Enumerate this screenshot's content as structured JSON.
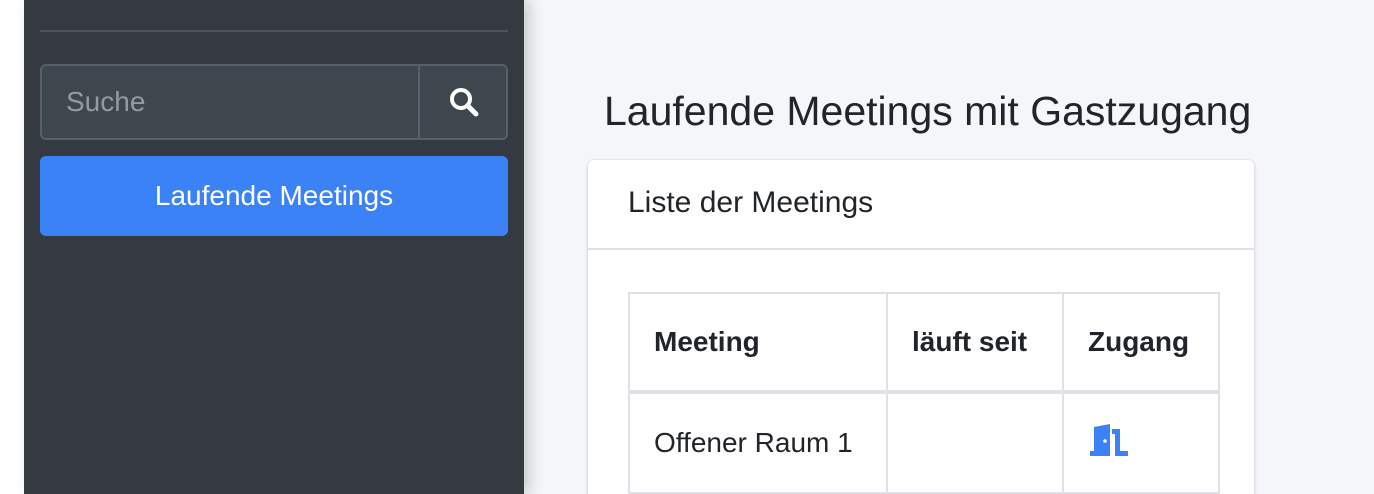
{
  "sidebar": {
    "search": {
      "placeholder": "Suche",
      "value": "",
      "button_icon": "search-icon"
    },
    "nav_items": [
      {
        "label": "Laufende Meetings",
        "active": true
      }
    ]
  },
  "main": {
    "page_title": "Laufende Meetings mit Gastzugang",
    "card": {
      "title": "Liste der Meetings",
      "table": {
        "headers": [
          "Meeting",
          "läuft seit",
          "Zugang"
        ],
        "rows": [
          {
            "meeting": "Offener Raum 1",
            "since": "",
            "access_icon": "door-open-icon"
          }
        ]
      }
    }
  },
  "colors": {
    "sidebar_bg": "#343a40",
    "accent": "#3b82f6",
    "page_bg": "#f4f6f9"
  }
}
